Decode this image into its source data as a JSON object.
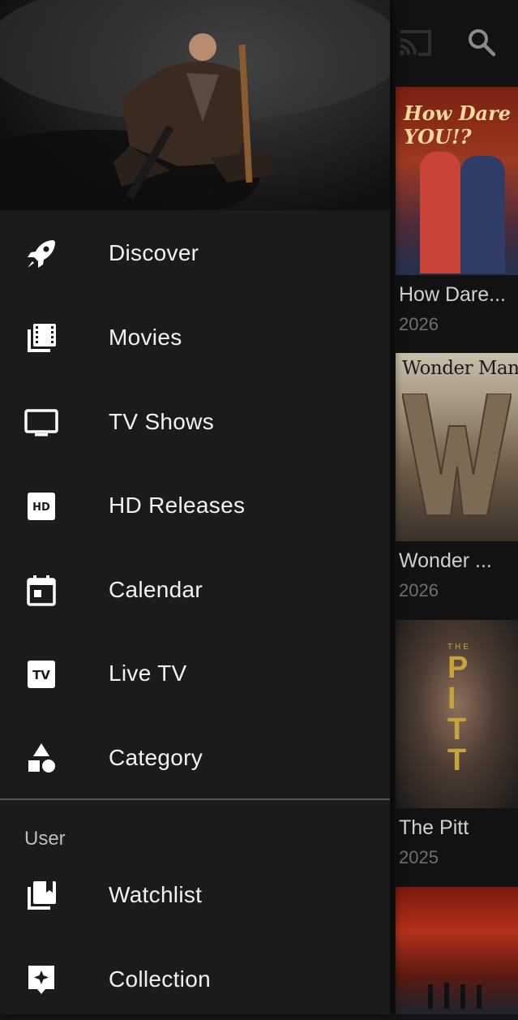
{
  "background_cards": [
    {
      "title": "How Dare...",
      "year": "2026",
      "poster_text": "How Dare YOU!?"
    },
    {
      "title": "Wonder ...",
      "year": "2026",
      "poster_text": "Wonder Man"
    },
    {
      "title": "The Pitt",
      "year": "2025",
      "poster_text_small": "THE",
      "poster_text": "PITT"
    },
    {
      "title": "",
      "year": "",
      "poster_text": ""
    }
  ],
  "drawer": {
    "menu": [
      {
        "label": "Discover",
        "icon": "rocket-icon"
      },
      {
        "label": "Movies",
        "icon": "film-library-icon"
      },
      {
        "label": "TV Shows",
        "icon": "tv-icon"
      },
      {
        "label": "HD Releases",
        "icon": "hd-icon"
      },
      {
        "label": "Calendar",
        "icon": "calendar-icon"
      },
      {
        "label": "Live TV",
        "icon": "live-tv-icon"
      },
      {
        "label": "Category",
        "icon": "shapes-icon"
      }
    ],
    "user_section": {
      "label": "User",
      "items": [
        {
          "label": "Watchlist",
          "icon": "watchlist-icon"
        },
        {
          "label": "Collection",
          "icon": "collection-icon"
        }
      ]
    }
  },
  "colors": {
    "drawer_bg": "#1b1b1b",
    "app_bg": "#121212",
    "text": "#f2f2f2",
    "muted": "#6f6f6f"
  }
}
